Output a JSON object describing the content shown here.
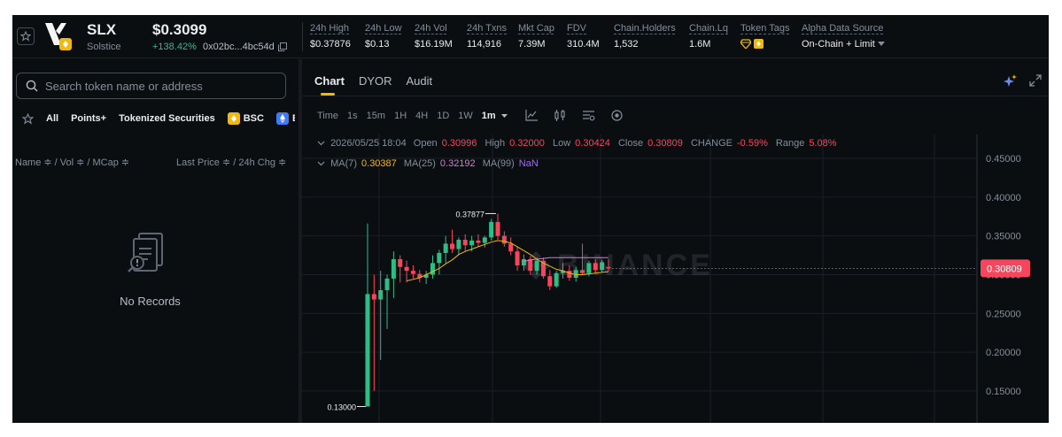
{
  "token": {
    "symbol": "SLX",
    "name": "Solstice",
    "price": "$0.3099",
    "change": "+138.42%",
    "address": "0x02bc...4bc54d"
  },
  "stats": [
    {
      "label": "24h High",
      "value": "$0.37876"
    },
    {
      "label": "24h Low",
      "value": "$0.13"
    },
    {
      "label": "24h Vol",
      "value": "$16.19M"
    },
    {
      "label": "24h Txns",
      "value": "114,916"
    },
    {
      "label": "Mkt Cap",
      "value": "7.39M"
    },
    {
      "label": "FDV",
      "value": "310.4M"
    },
    {
      "label": "Chain.Holders",
      "value": "1,532"
    },
    {
      "label": "Chain.Lq",
      "value": "1.6M"
    },
    {
      "label": "Token Tags",
      "value": ""
    },
    {
      "label": "Alpha Data Source",
      "value": "On-Chain + Limit"
    }
  ],
  "left": {
    "search_placeholder": "Search token name or address",
    "filters": [
      "All",
      "Points+",
      "Tokenized Securities",
      "BSC",
      "E"
    ],
    "col_left": "Name ≑ / Vol ≑ / MCap ≑",
    "col_right": "Last Price ≑ / 24h Chg ≑",
    "empty": "No Records"
  },
  "chart_panel": {
    "tabs": [
      "Chart",
      "DYOR",
      "Audit"
    ],
    "intervals": [
      "Time",
      "1s",
      "15m",
      "1H",
      "4H",
      "1D",
      "1W",
      "1m"
    ],
    "selected_interval": "1m",
    "ohlc": {
      "date": "2026/05/25 18:04",
      "open_label": "Open",
      "open": "0.30996",
      "high_label": "High",
      "high": "0.32000",
      "low_label": "Low",
      "low": "0.30424",
      "close_label": "Close",
      "close": "0.30809",
      "change_label": "CHANGE",
      "change": "-0.59%",
      "range_label": "Range",
      "range": "5.08%"
    },
    "ma": {
      "ma7_label": "MA(7)",
      "ma7": "0.30387",
      "ma25_label": "MA(25)",
      "ma25": "0.32192",
      "ma99_label": "MA(99)",
      "ma99": "NaN"
    },
    "watermark": "BINANCE"
  },
  "colors": {
    "up": "#2ebd85",
    "down": "#f6465d",
    "accent": "#f0b90b",
    "ma7": "#f0b90b",
    "ma25": "#d977dc"
  },
  "chart_data": {
    "type": "candlestick",
    "y_ticks": [
      "0.45000",
      "0.40000",
      "0.35000",
      "0.30000",
      "0.25000",
      "0.20000",
      "0.15000"
    ],
    "ylim": [
      0.12,
      0.47
    ],
    "last_price": "0.30809",
    "high_label": "0.37877",
    "low_label": "0.13000",
    "candles": [
      {
        "o": 0.13,
        "h": 0.366,
        "l": 0.13,
        "c": 0.275
      },
      {
        "o": 0.275,
        "h": 0.3,
        "l": 0.15,
        "c": 0.268
      },
      {
        "o": 0.268,
        "h": 0.305,
        "l": 0.19,
        "c": 0.28
      },
      {
        "o": 0.28,
        "h": 0.3,
        "l": 0.23,
        "c": 0.295
      },
      {
        "o": 0.295,
        "h": 0.33,
        "l": 0.27,
        "c": 0.32
      },
      {
        "o": 0.32,
        "h": 0.325,
        "l": 0.29,
        "c": 0.31
      },
      {
        "o": 0.31,
        "h": 0.318,
        "l": 0.29,
        "c": 0.305
      },
      {
        "o": 0.305,
        "h": 0.312,
        "l": 0.295,
        "c": 0.301
      },
      {
        "o": 0.301,
        "h": 0.306,
        "l": 0.29,
        "c": 0.296
      },
      {
        "o": 0.296,
        "h": 0.305,
        "l": 0.288,
        "c": 0.3
      },
      {
        "o": 0.3,
        "h": 0.325,
        "l": 0.295,
        "c": 0.315
      },
      {
        "o": 0.315,
        "h": 0.332,
        "l": 0.3,
        "c": 0.328
      },
      {
        "o": 0.328,
        "h": 0.35,
        "l": 0.315,
        "c": 0.34
      },
      {
        "o": 0.34,
        "h": 0.358,
        "l": 0.328,
        "c": 0.333
      },
      {
        "o": 0.333,
        "h": 0.348,
        "l": 0.325,
        "c": 0.345
      },
      {
        "o": 0.345,
        "h": 0.352,
        "l": 0.33,
        "c": 0.338
      },
      {
        "o": 0.338,
        "h": 0.35,
        "l": 0.33,
        "c": 0.344
      },
      {
        "o": 0.344,
        "h": 0.352,
        "l": 0.336,
        "c": 0.341
      },
      {
        "o": 0.341,
        "h": 0.35,
        "l": 0.335,
        "c": 0.348
      },
      {
        "o": 0.348,
        "h": 0.372,
        "l": 0.344,
        "c": 0.368
      },
      {
        "o": 0.368,
        "h": 0.37877,
        "l": 0.345,
        "c": 0.35
      },
      {
        "o": 0.35,
        "h": 0.356,
        "l": 0.336,
        "c": 0.34
      },
      {
        "o": 0.34,
        "h": 0.348,
        "l": 0.325,
        "c": 0.33
      },
      {
        "o": 0.33,
        "h": 0.336,
        "l": 0.305,
        "c": 0.312
      },
      {
        "o": 0.312,
        "h": 0.326,
        "l": 0.305,
        "c": 0.32
      },
      {
        "o": 0.32,
        "h": 0.324,
        "l": 0.3,
        "c": 0.305
      },
      {
        "o": 0.305,
        "h": 0.322,
        "l": 0.3,
        "c": 0.318
      },
      {
        "o": 0.318,
        "h": 0.322,
        "l": 0.295,
        "c": 0.298
      },
      {
        "o": 0.298,
        "h": 0.306,
        "l": 0.28,
        "c": 0.285
      },
      {
        "o": 0.285,
        "h": 0.305,
        "l": 0.283,
        "c": 0.302
      },
      {
        "o": 0.302,
        "h": 0.315,
        "l": 0.295,
        "c": 0.305
      },
      {
        "o": 0.305,
        "h": 0.312,
        "l": 0.292,
        "c": 0.296
      },
      {
        "o": 0.296,
        "h": 0.31,
        "l": 0.291,
        "c": 0.306
      },
      {
        "o": 0.306,
        "h": 0.34,
        "l": 0.3,
        "c": 0.302
      },
      {
        "o": 0.302,
        "h": 0.318,
        "l": 0.298,
        "c": 0.315
      },
      {
        "o": 0.315,
        "h": 0.32,
        "l": 0.302,
        "c": 0.306
      },
      {
        "o": 0.306,
        "h": 0.319,
        "l": 0.303,
        "c": 0.316
      },
      {
        "o": 0.30996,
        "h": 0.32,
        "l": 0.30424,
        "c": 0.30809
      }
    ],
    "ma7": [
      null,
      null,
      null,
      null,
      null,
      null,
      0.292,
      0.294,
      0.296,
      0.3,
      0.304,
      0.308,
      0.314,
      0.319,
      0.326,
      0.33,
      0.333,
      0.336,
      0.339,
      0.342,
      0.344,
      0.343,
      0.341,
      0.336,
      0.331,
      0.326,
      0.32,
      0.315,
      0.311,
      0.307,
      0.305,
      0.302,
      0.3,
      0.3,
      0.301,
      0.302,
      0.303,
      0.30387
    ],
    "ma25": [
      null,
      null,
      null,
      null,
      null,
      null,
      null,
      null,
      null,
      null,
      null,
      null,
      null,
      null,
      null,
      null,
      null,
      null,
      null,
      null,
      null,
      null,
      null,
      null,
      0.317,
      0.319,
      0.32,
      0.321,
      0.322,
      0.322,
      0.322,
      0.322,
      0.322,
      0.322,
      0.322,
      0.322,
      0.322,
      0.32192
    ]
  }
}
